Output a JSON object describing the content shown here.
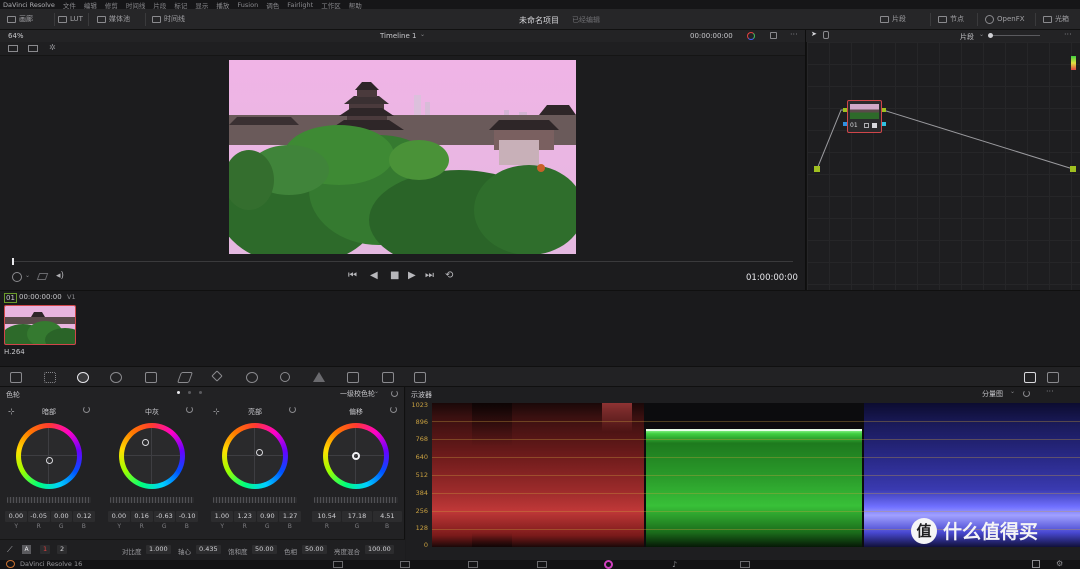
{
  "app": {
    "name": "DaVinci Resolve",
    "version_label": "DaVinci Resolve 16"
  },
  "menu": [
    "文件",
    "编辑",
    "修剪",
    "时间线",
    "片段",
    "标记",
    "显示",
    "播放",
    "Fusion",
    "调色",
    "Fairlight",
    "工作区",
    "帮助"
  ],
  "toolbar": {
    "left": [
      {
        "label": "画廊",
        "icon": "gallery-icon"
      },
      {
        "label": "LUT",
        "icon": "lut-icon"
      },
      {
        "label": "媒体池",
        "icon": "media-pool-icon"
      },
      {
        "label": "时间线",
        "icon": "timeline-icon"
      }
    ],
    "project_title": "未命名项目",
    "project_status": "已经编辑",
    "right": [
      {
        "label": "片段",
        "icon": "clips-icon"
      },
      {
        "label": "节点",
        "icon": "nodes-icon"
      },
      {
        "label": "OpenFX",
        "icon": "openfx-icon"
      },
      {
        "label": "光箱",
        "icon": "lightbox-icon"
      }
    ]
  },
  "viewer": {
    "zoom": "64%",
    "timeline_name": "Timeline 1",
    "timecode": "00:00:00:00",
    "playhead_timecode": "01:00:00:00",
    "node_mode": "片段"
  },
  "node": {
    "label": "01"
  },
  "clips": {
    "track_index": "01",
    "clip_timecode": "00:00:00:00",
    "track_name": "V1",
    "clip_codec": "H.264"
  },
  "color_wheels": {
    "panel_title": "色轮",
    "mode": "一级校色轮",
    "wheels": [
      {
        "title": "暗部",
        "values": [
          "0.00",
          "-0.05",
          "0.00",
          "0.12"
        ],
        "channels": [
          "Y",
          "R",
          "G",
          "B"
        ]
      },
      {
        "title": "中灰",
        "values": [
          "0.00",
          "0.16",
          "-0.63",
          "-0.10"
        ],
        "channels": [
          "Y",
          "R",
          "G",
          "B"
        ]
      },
      {
        "title": "亮部",
        "values": [
          "1.00",
          "1.23",
          "0.90",
          "1.27"
        ],
        "channels": [
          "Y",
          "R",
          "G",
          "B"
        ]
      },
      {
        "title": "偏移",
        "values": [
          "10.54",
          "17.18",
          "4.51"
        ],
        "channels": [
          "R",
          "G",
          "B"
        ]
      }
    ],
    "bottom": {
      "page_1": "1",
      "page_2": "2",
      "contrast_label": "对比度",
      "contrast": "1.000",
      "pivot_label": "轴心",
      "pivot": "0.435",
      "saturation_label": "饱和度",
      "saturation": "50.00",
      "hue_label": "色相",
      "hue": "50.00",
      "lum_mix_label": "亮度混合",
      "lum_mix": "100.00"
    }
  },
  "scopes": {
    "title": "示波器",
    "mode": "分量图",
    "y_ticks": [
      "1023",
      "896",
      "768",
      "640",
      "512",
      "384",
      "256",
      "128",
      "0"
    ]
  },
  "watermark": "什么值得买",
  "colors": {
    "accent": "#d0464a",
    "scope_r": "#e04040",
    "scope_g": "#40e040",
    "scope_b": "#4848ff",
    "tick": "#c8a040"
  }
}
